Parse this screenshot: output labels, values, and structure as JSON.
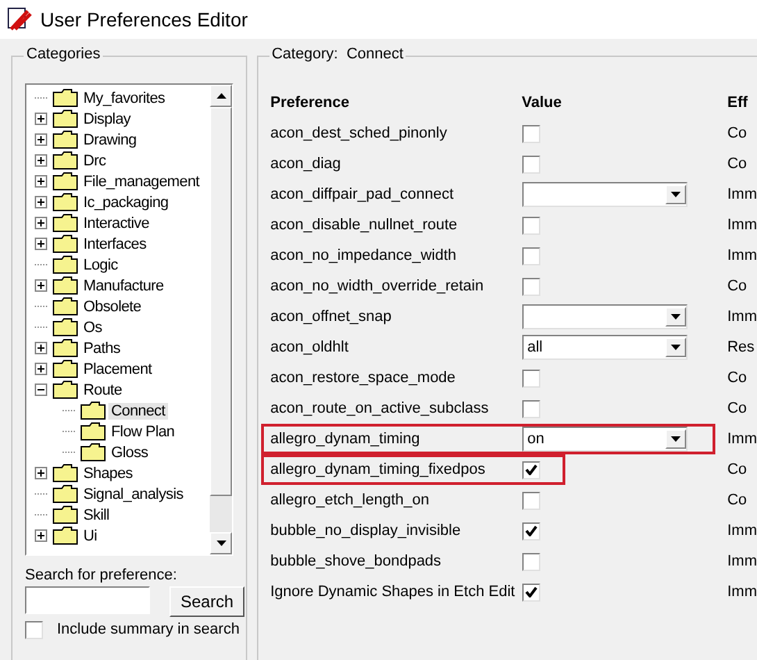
{
  "window": {
    "title": "User Preferences Editor"
  },
  "categories": {
    "legend": "Categories",
    "items": [
      {
        "label": "My_favorites",
        "selected": false
      },
      {
        "label": "Display",
        "expanded": false,
        "selected": false
      },
      {
        "label": "Drawing",
        "expanded": false,
        "selected": false
      },
      {
        "label": "Drc",
        "expanded": false,
        "selected": false
      },
      {
        "label": "File_management",
        "expanded": false,
        "selected": false
      },
      {
        "label": "Ic_packaging",
        "expanded": false,
        "selected": false
      },
      {
        "label": "Interactive",
        "expanded": false,
        "selected": false
      },
      {
        "label": "Interfaces",
        "expanded": false,
        "selected": false
      },
      {
        "label": "Logic",
        "selected": false
      },
      {
        "label": "Manufacture",
        "expanded": false,
        "selected": false
      },
      {
        "label": "Obsolete",
        "selected": false
      },
      {
        "label": "Os",
        "selected": false
      },
      {
        "label": "Paths",
        "expanded": false,
        "selected": false
      },
      {
        "label": "Placement",
        "expanded": false,
        "selected": false
      },
      {
        "label": "Route",
        "expanded": true,
        "selected": false,
        "children": [
          {
            "label": "Connect",
            "selected": true
          },
          {
            "label": "Flow Plan",
            "selected": false
          },
          {
            "label": "Gloss",
            "selected": false
          }
        ]
      },
      {
        "label": "Shapes",
        "expanded": false,
        "selected": false
      },
      {
        "label": "Signal_analysis",
        "selected": false
      },
      {
        "label": "Skill",
        "selected": false
      },
      {
        "label": "Ui",
        "expanded": false,
        "selected": false
      }
    ],
    "search_label": "Search for preference:",
    "search_button": "Search",
    "include_summary": {
      "label": "Include summary in search",
      "checked": false
    }
  },
  "panel": {
    "legend_label": "Category:",
    "legend_value": "Connect",
    "columns": [
      "Preference",
      "Value",
      "Eff"
    ],
    "rows": [
      {
        "name": "acon_dest_sched_pinonly",
        "kind": "checkbox",
        "checked": false,
        "effect": "Co",
        "highlighted": false
      },
      {
        "name": "acon_diag",
        "kind": "checkbox",
        "checked": false,
        "effect": "Co",
        "highlighted": false
      },
      {
        "name": "acon_diffpair_pad_connect",
        "kind": "dropdown",
        "effect": "Imm",
        "highlighted": false
      },
      {
        "name": "acon_disable_nullnet_route",
        "kind": "checkbox",
        "checked": false,
        "effect": "Imm",
        "highlighted": false
      },
      {
        "name": "acon_no_impedance_width",
        "kind": "checkbox",
        "checked": false,
        "effect": "Imm",
        "highlighted": false
      },
      {
        "name": "acon_no_width_override_retain",
        "kind": "checkbox",
        "checked": false,
        "effect": "Co",
        "highlighted": false
      },
      {
        "name": "acon_offnet_snap",
        "kind": "dropdown",
        "effect": "Imm",
        "highlighted": false
      },
      {
        "name": "acon_oldhlt",
        "kind": "dropdown",
        "value": "all",
        "effect": "Res",
        "highlighted": false
      },
      {
        "name": "acon_restore_space_mode",
        "kind": "checkbox",
        "checked": false,
        "effect": "Co",
        "highlighted": false
      },
      {
        "name": "acon_route_on_active_subclass",
        "kind": "checkbox",
        "checked": false,
        "effect": "Co",
        "highlighted": false
      },
      {
        "name": "allegro_dynam_timing",
        "kind": "dropdown",
        "value": "on",
        "effect": "Imm",
        "highlighted": true
      },
      {
        "name": "allegro_dynam_timing_fixedpos",
        "kind": "checkbox",
        "checked": true,
        "effect": "Co",
        "highlighted": true
      },
      {
        "name": "allegro_etch_length_on",
        "kind": "checkbox",
        "checked": false,
        "effect": "Co",
        "highlighted": false
      },
      {
        "name": "bubble_no_display_invisible",
        "kind": "checkbox",
        "checked": true,
        "effect": "Imm",
        "highlighted": false
      },
      {
        "name": "bubble_shove_bondpads",
        "kind": "checkbox",
        "checked": false,
        "effect": "Imm",
        "highlighted": false
      },
      {
        "name": "Ignore Dynamic Shapes in Etch Edit",
        "kind": "checkbox",
        "checked": true,
        "effect": "Imm",
        "highlighted": false
      }
    ]
  }
}
